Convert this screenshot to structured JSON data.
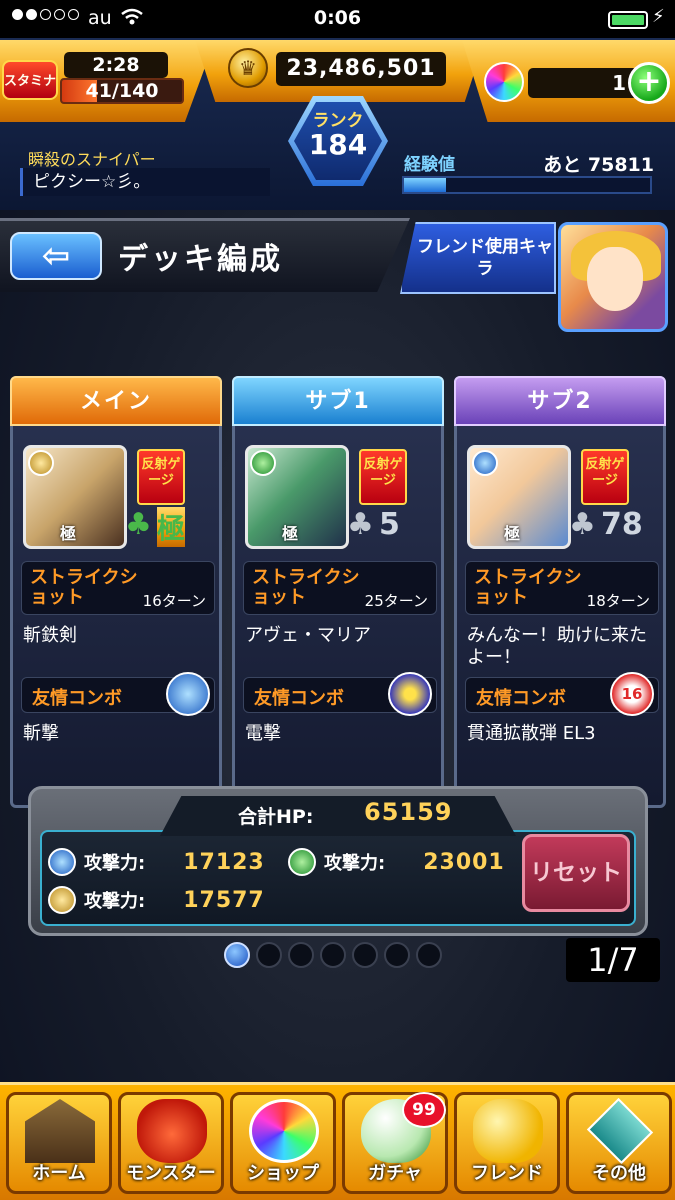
{
  "status": {
    "carrier": "au",
    "time": "0:06"
  },
  "header": {
    "stamina_label": "スタミナ",
    "stamina_timer": "2:28",
    "stamina": "41/140",
    "stamina_fraction": 0.293,
    "coins": "23,486,501",
    "stones": "1",
    "plus": "+",
    "rank_label": "ランク",
    "rank": "184",
    "player_title": "瞬殺のスナイパー",
    "player_name": "ピクシー☆彡。",
    "exp_label": "経験値",
    "exp_remaining": "あと 75811",
    "exp_fraction": 0.17
  },
  "page": {
    "title": "デッキ編成",
    "back": "⇦",
    "friend_button": "フレンド使用キャラ"
  },
  "cards": [
    {
      "slot": "メイン",
      "gauge": "反射ゲージ",
      "luck": "極",
      "kiwa": "極",
      "ss_label": "ストライクショット",
      "ss_turns": "16ターン",
      "ss_name": "斬鉄剣",
      "fc_label": "友情コンボ",
      "fc_name": "斬撃"
    },
    {
      "slot": "サブ1",
      "gauge": "反射ゲージ",
      "luck": "5",
      "kiwa": "極",
      "ss_label": "ストライクショット",
      "ss_turns": "25ターン",
      "ss_name": "アヴェ・マリア",
      "fc_label": "友情コンボ",
      "fc_name": "電撃"
    },
    {
      "slot": "サブ2",
      "gauge": "反射ゲージ",
      "luck": "78",
      "kiwa": "極",
      "ss_label": "ストライクショット",
      "ss_turns": "18ターン",
      "ss_name": "みんなー！助けに来たよー！",
      "fc_label": "友情コンボ",
      "fc_name": "貫通拡散弾 EL3",
      "fc_badge": "16"
    }
  ],
  "stats": {
    "hp_label": "合計HP:",
    "hp": "65159",
    "atk_label": "攻撃力:",
    "water": "17123",
    "wood": "23001",
    "light": "17577",
    "reset": "リセット"
  },
  "pager": {
    "current": "1",
    "total": "7",
    "display": "1/7"
  },
  "nav": {
    "home": "ホーム",
    "monster": "モンスター",
    "shop": "ショップ",
    "gacha": "ガチャ",
    "friend": "フレンド",
    "other": "その他",
    "gacha_badge": "99"
  },
  "colors": {
    "accent_gold": "#f2a20c",
    "main_tab": "#e06a08",
    "sub1_tab": "#1a80d0",
    "sub2_tab": "#6a42b8",
    "ss_text": "#ff9a26"
  }
}
